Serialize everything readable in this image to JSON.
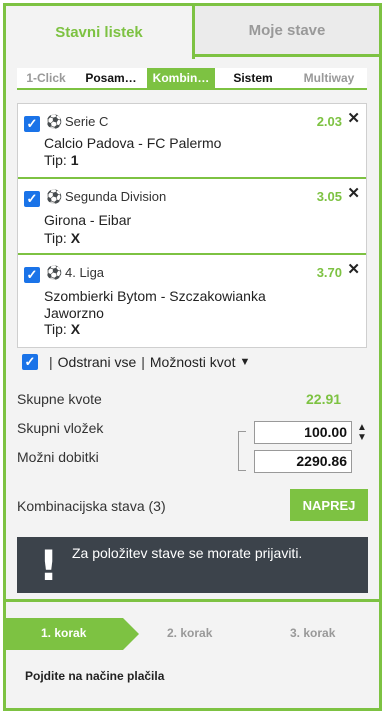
{
  "tabs": {
    "active": "Stavni listek",
    "inactive": "Moje stave"
  },
  "sub_tabs": [
    "1-Click",
    "Posam…",
    "Kombin…",
    "Sistem",
    "Multiway"
  ],
  "bets": [
    {
      "league": "Serie C",
      "odds": "2.03",
      "match": "Calcio Padova - FC Palermo",
      "tip_label": "Tip:",
      "tip": "1"
    },
    {
      "league": "Segunda Division",
      "odds": "3.05",
      "match": "Girona - Eibar",
      "tip_label": "Tip:",
      "tip": "X"
    },
    {
      "league": "4. Liga",
      "odds": "3.70",
      "match": "Szombierki Bytom - Szczakowianka Jaworzno",
      "tip_label": "Tip:",
      "tip": "X"
    }
  ],
  "actions": {
    "remove_all": "Odstrani vse",
    "options": "Možnosti kvot"
  },
  "totals": {
    "total_odds_label": "Skupne kvote",
    "total_odds": "22.91",
    "stake_label": "Skupni vložek",
    "stake": "100.00",
    "win_label": "Možni dobitki",
    "win": "2290.86"
  },
  "combo": {
    "label": "Kombinacijska stava (3)",
    "button": "NAPREJ"
  },
  "notice": {
    "message": "Za položitev stave se morate prijaviti."
  },
  "steps": [
    "1. korak",
    "2. korak",
    "3. korak"
  ],
  "hint": "Pojdite na načine plačila",
  "colors": {
    "accent": "#7dc242",
    "notice_bg": "#3c434b",
    "checkbox": "#1a73e8"
  }
}
